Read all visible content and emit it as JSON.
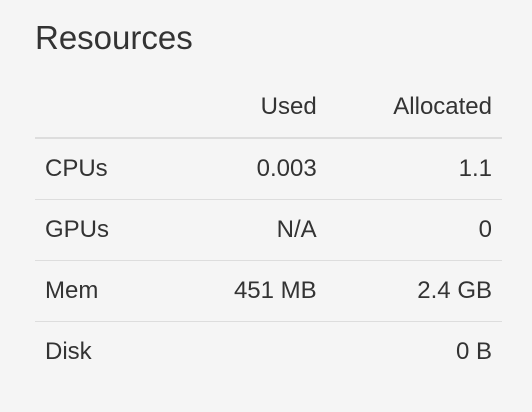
{
  "panel": {
    "title": "Resources"
  },
  "table": {
    "headers": {
      "name": "",
      "used": "Used",
      "allocated": "Allocated"
    },
    "rows": [
      {
        "name": "CPUs",
        "used": "0.003",
        "allocated": "1.1"
      },
      {
        "name": "GPUs",
        "used": "N/A",
        "allocated": "0"
      },
      {
        "name": "Mem",
        "used": "451 MB",
        "allocated": "2.4 GB"
      },
      {
        "name": "Disk",
        "used": "",
        "allocated": "0 B"
      }
    ]
  }
}
